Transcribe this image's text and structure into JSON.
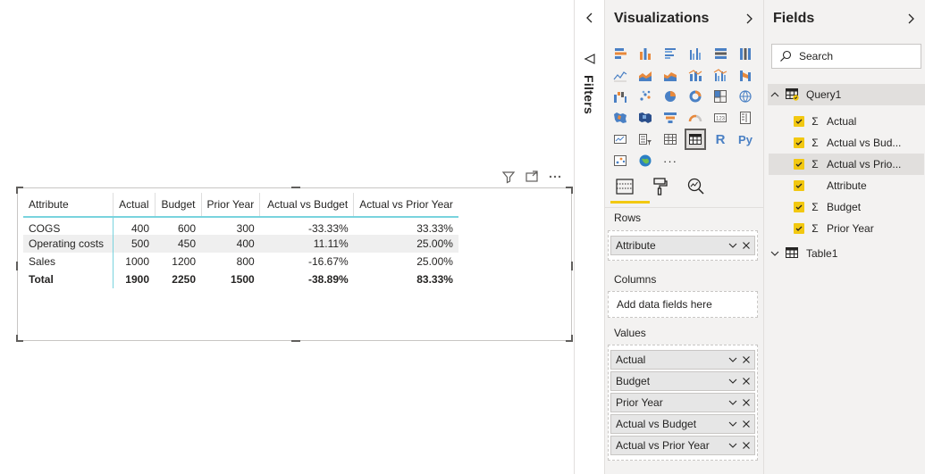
{
  "table": {
    "columns": [
      "Attribute",
      "Actual",
      "Budget",
      "Prior Year",
      "Actual vs Budget",
      "Actual vs Prior Year"
    ],
    "rows": [
      [
        "COGS",
        "400",
        "600",
        "300",
        "-33.33%",
        "33.33%"
      ],
      [
        "Operating costs",
        "500",
        "450",
        "400",
        "11.11%",
        "25.00%"
      ],
      [
        "Sales",
        "1000",
        "1200",
        "800",
        "-16.67%",
        "25.00%"
      ]
    ],
    "total": [
      "Total",
      "1900",
      "2250",
      "1500",
      "-38.89%",
      "83.33%"
    ]
  },
  "filters": {
    "label": "Filters"
  },
  "visualizations": {
    "title": "Visualizations",
    "r_label": "R",
    "py_label": "Py",
    "more_label": "···",
    "wells": {
      "rows_label": "Rows",
      "rows_fields": [
        "Attribute"
      ],
      "columns_label": "Columns",
      "columns_placeholder": "Add data fields here",
      "values_label": "Values",
      "values_fields": [
        "Actual",
        "Budget",
        "Prior Year",
        "Actual vs Budget",
        "Actual vs Prior Year"
      ]
    }
  },
  "fields_pane": {
    "title": "Fields",
    "search_placeholder": "Search",
    "tables": [
      {
        "name": "Query1",
        "expanded": true,
        "fields": [
          {
            "label": "Actual",
            "checked": true,
            "sigma": true
          },
          {
            "label": "Actual vs Bud...",
            "checked": true,
            "sigma": true
          },
          {
            "label": "Actual vs Prio...",
            "checked": true,
            "sigma": true
          },
          {
            "label": "Attribute",
            "checked": true,
            "sigma": false
          },
          {
            "label": "Budget",
            "checked": true,
            "sigma": true
          },
          {
            "label": "Prior Year",
            "checked": true,
            "sigma": true
          }
        ]
      },
      {
        "name": "Table1",
        "expanded": false,
        "fields": []
      }
    ]
  },
  "colors": {
    "accent_yellow": "#f2c811",
    "table_rule_teal": "#79d3de",
    "pane_bg": "#f3f2f1",
    "icon_blue": "#4a80c4",
    "icon_orange": "#e8893c"
  }
}
